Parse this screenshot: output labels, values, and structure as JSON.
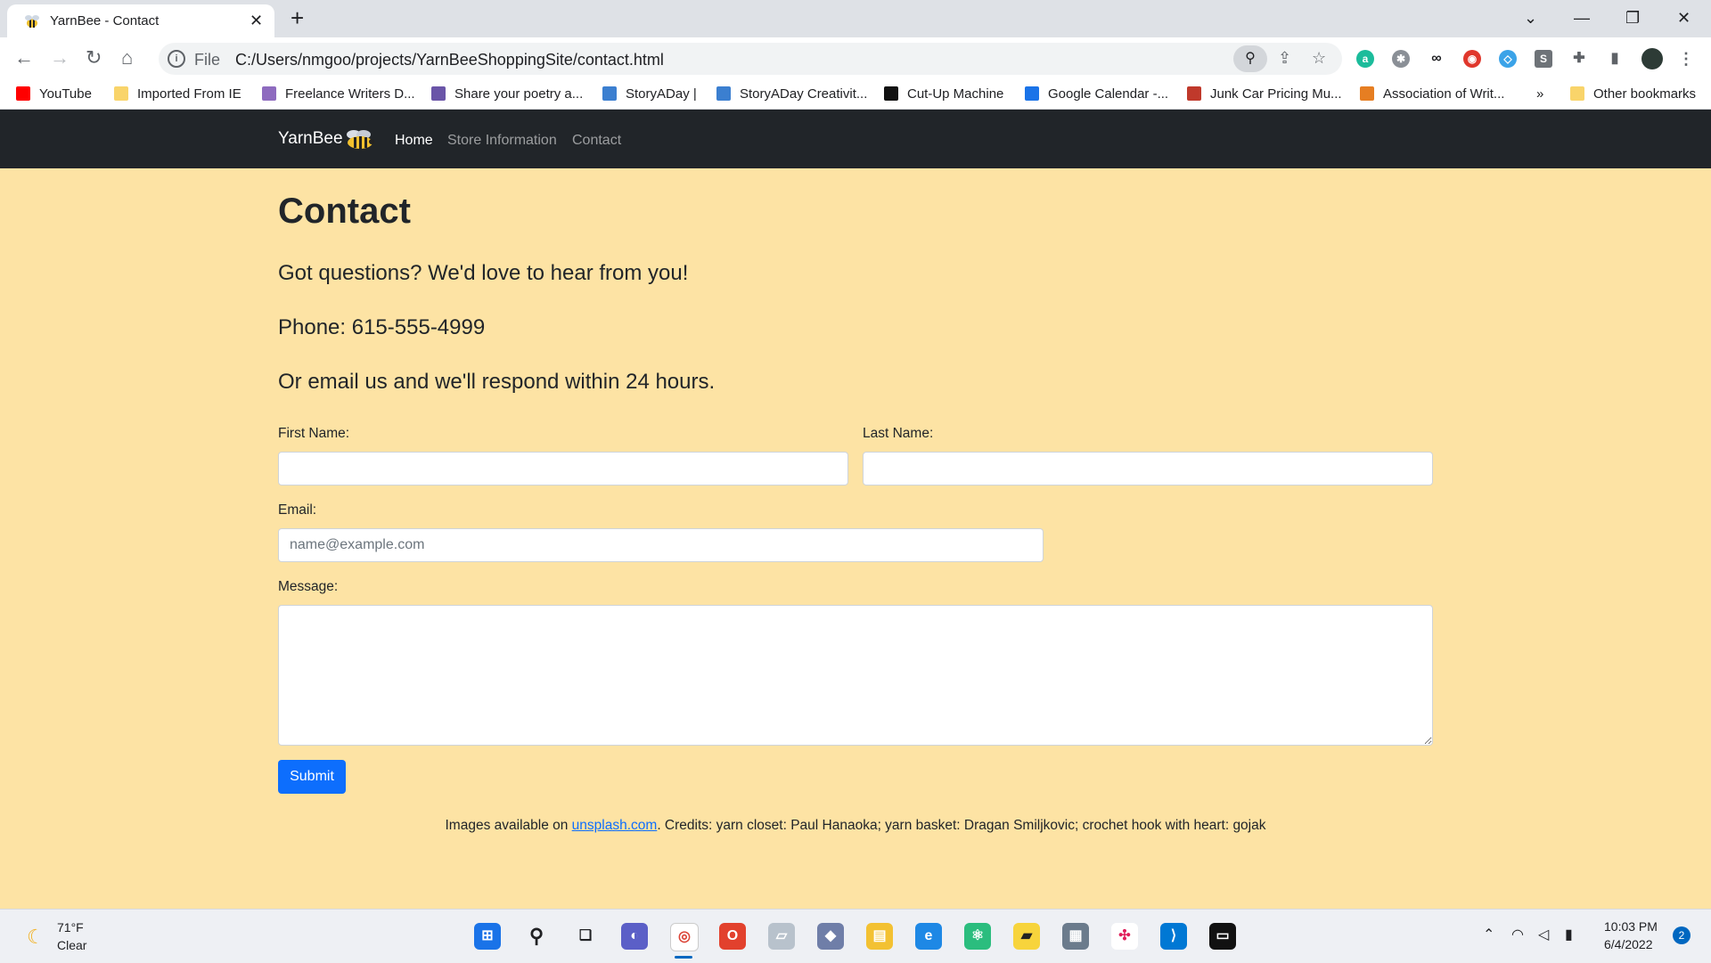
{
  "browser": {
    "tab_title": "YarnBee - Contact",
    "close_glyph": "✕",
    "new_tab_glyph": "+",
    "address_scheme": "File",
    "address_url": "C:/Users/nmgoo/projects/YarnBeeShoppingSite/contact.html",
    "bookmarks": [
      {
        "label": "YouTube",
        "color": "#ff0000"
      },
      {
        "label": "Imported From IE",
        "color": "#f9d46a"
      },
      {
        "label": "Freelance Writers D...",
        "color": "#8e6bbf"
      },
      {
        "label": "Share your poetry a...",
        "color": "#6a55a8"
      },
      {
        "label": "StoryADay |",
        "color": "#3b7fd0"
      },
      {
        "label": "StoryADay Creativit...",
        "color": "#3b7fd0"
      },
      {
        "label": "Cut-Up Machine",
        "color": "#111111"
      },
      {
        "label": "Google Calendar -...",
        "color": "#1a73e8"
      },
      {
        "label": "Junk Car Pricing Mu...",
        "color": "#c0392b"
      },
      {
        "label": "Association of Writ...",
        "color": "#e67e22"
      }
    ],
    "bookmarks_overflow": "»",
    "other_bookmarks": "Other bookmarks"
  },
  "site": {
    "brand": "YarnBee",
    "nav": [
      {
        "label": "Home",
        "active": true
      },
      {
        "label": "Store Information",
        "active": false
      },
      {
        "label": "Contact",
        "active": false
      }
    ]
  },
  "contact": {
    "heading": "Contact",
    "intro": "Got questions? We'd love to hear from you!",
    "phone": "Phone: 615-555-4999",
    "email_note": "Or email us and we'll respond within 24 hours.",
    "first_name_label": "First Name:",
    "first_name_value": "",
    "last_name_label": "Last Name:",
    "last_name_value": "",
    "email_label": "Email:",
    "email_placeholder": "name@example.com",
    "message_label": "Message:",
    "submit_label": "Submit"
  },
  "footer": {
    "prefix": "Images available on ",
    "link": "unsplash.com",
    "suffix": ". Credits: yarn closet: Paul Hanaoka; yarn basket: Dragan Smiljkovic; crochet hook with heart: gojak"
  },
  "taskbar": {
    "temperature": "71°F",
    "condition": "Clear",
    "time": "10:03 PM",
    "date": "6/4/2022",
    "notifications": "2"
  },
  "colors": {
    "page_background": "#fde3a4",
    "navbar": "#212529",
    "primary_button": "#0d6efd"
  }
}
